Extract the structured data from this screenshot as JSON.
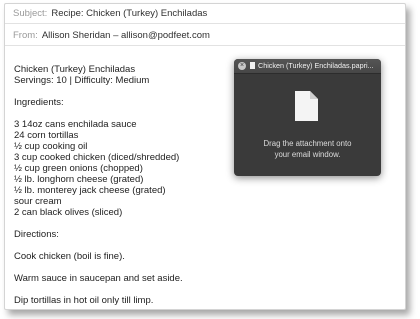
{
  "header": {
    "subject_label": "Subject:",
    "subject": "Recipe: Chicken (Turkey) Enchiladas",
    "from_label": "From:",
    "from": "Allison Sheridan – allison@podfeet.com"
  },
  "body": {
    "lines": [
      "Chicken (Turkey) Enchiladas",
      "Servings: 10 | Difficulty: Medium",
      "",
      "Ingredients:",
      "",
      "3 14oz cans enchilada sauce",
      "24 corn tortillas",
      "½ cup cooking oil",
      "3 cup cooked chicken (diced/shredded)",
      "½ cup green onions (chopped)",
      "½ lb. longhorn cheese (grated)",
      "½ lb. monterey jack cheese (grated)",
      "sour cream",
      "2 can black olives (sliced)",
      "",
      "Directions:",
      "",
      "Cook chicken (boil is fine).",
      "",
      "Warm sauce in saucepan and set aside.",
      "",
      "Dip tortillas in hot oil only till limp."
    ]
  },
  "attachment_panel": {
    "title": "Chicken (Turkey) Enchiladas.papri...",
    "close_icon": "close-icon",
    "file_icon": "document-icon",
    "message_line1": "Drag the attachment onto",
    "message_line2": "your email window."
  },
  "colors": {
    "panel_bg": "#3a3a3a",
    "label_gray": "#9a9a9a"
  }
}
